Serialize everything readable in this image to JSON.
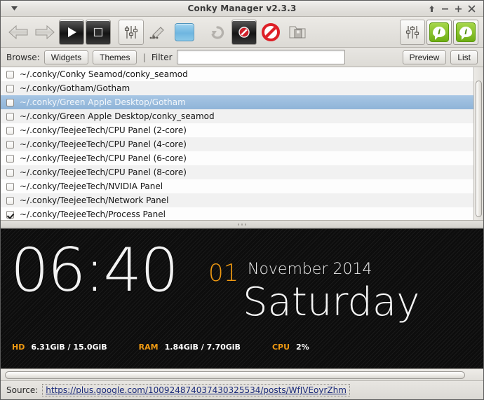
{
  "window": {
    "title": "Conky Manager v2.3.3",
    "menu_icon": "menu-caret-icon",
    "controls": [
      {
        "name": "shade-button",
        "glyph": "↑"
      },
      {
        "name": "minimize-button",
        "glyph": "−"
      },
      {
        "name": "maximize-button",
        "glyph": "+"
      },
      {
        "name": "close-button",
        "glyph": "×"
      }
    ]
  },
  "toolbar": {
    "items": [
      {
        "name": "previous-button",
        "icon": "left-arrow-icon"
      },
      {
        "name": "next-button",
        "icon": "right-arrow-icon"
      },
      {
        "name": "start-button",
        "icon": "play-icon"
      },
      {
        "name": "stop-button",
        "icon": "stop-icon"
      },
      {
        "name": "settings-button",
        "icon": "sliders-icon"
      },
      {
        "name": "edit-button",
        "icon": "pencil-icon"
      },
      {
        "name": "theme-color-button",
        "icon": "blue-square-icon"
      },
      {
        "name": "reload-button",
        "icon": "undo-arrow-icon"
      },
      {
        "name": "kill-conky-button",
        "icon": "prohibited-dark-icon"
      },
      {
        "name": "disable-all-button",
        "icon": "prohibited-icon"
      },
      {
        "name": "backup-button",
        "icon": "folder-archive-icon"
      },
      {
        "name": "preferences-button",
        "icon": "sliders-icon"
      },
      {
        "name": "info-button",
        "icon": "green-info-icon"
      },
      {
        "name": "about-button",
        "icon": "green-info-icon"
      }
    ],
    "info_glyph": "i"
  },
  "browse": {
    "label": "Browse:",
    "widgets_label": "Widgets",
    "themes_label": "Themes",
    "separator": "|",
    "filter_label": "Filter",
    "filter_value": "",
    "filter_placeholder": "",
    "preview_label": "Preview",
    "list_label": "List"
  },
  "list": {
    "rows": [
      {
        "label": "~/.conky/Conky Seamod/conky_seamod",
        "checked": false,
        "selected": false
      },
      {
        "label": "~/.conky/Gotham/Gotham",
        "checked": false,
        "selected": false
      },
      {
        "label": "~/.conky/Green Apple Desktop/Gotham",
        "checked": false,
        "selected": true
      },
      {
        "label": "~/.conky/Green Apple Desktop/conky_seamod",
        "checked": false,
        "selected": false
      },
      {
        "label": "~/.conky/TeejeeTech/CPU Panel (2-core)",
        "checked": false,
        "selected": false
      },
      {
        "label": "~/.conky/TeejeeTech/CPU Panel (4-core)",
        "checked": false,
        "selected": false
      },
      {
        "label": "~/.conky/TeejeeTech/CPU Panel (6-core)",
        "checked": false,
        "selected": false
      },
      {
        "label": "~/.conky/TeejeeTech/CPU Panel (8-core)",
        "checked": false,
        "selected": false
      },
      {
        "label": "~/.conky/TeejeeTech/NVIDIA Panel",
        "checked": false,
        "selected": false
      },
      {
        "label": "~/.conky/TeejeeTech/Network Panel",
        "checked": false,
        "selected": false
      },
      {
        "label": "~/.conky/TeejeeTech/Process Panel",
        "checked": true,
        "selected": false
      }
    ]
  },
  "preview": {
    "time": "06:40",
    "day_number": "01",
    "month_year": "November 2014",
    "weekday": "Saturday",
    "accent_color": "#f09a12",
    "stats": {
      "hd_label": "HD",
      "hd_value": "6.31GiB / 15.0GiB",
      "ram_label": "RAM",
      "ram_value": "1.84GiB / 7.70GiB",
      "cpu_label": "CPU",
      "cpu_value": "2%"
    }
  },
  "source": {
    "label": "Source:",
    "url": "https://plus.google.com/100924874037430325534/posts/WfJVEoyrZhm"
  }
}
